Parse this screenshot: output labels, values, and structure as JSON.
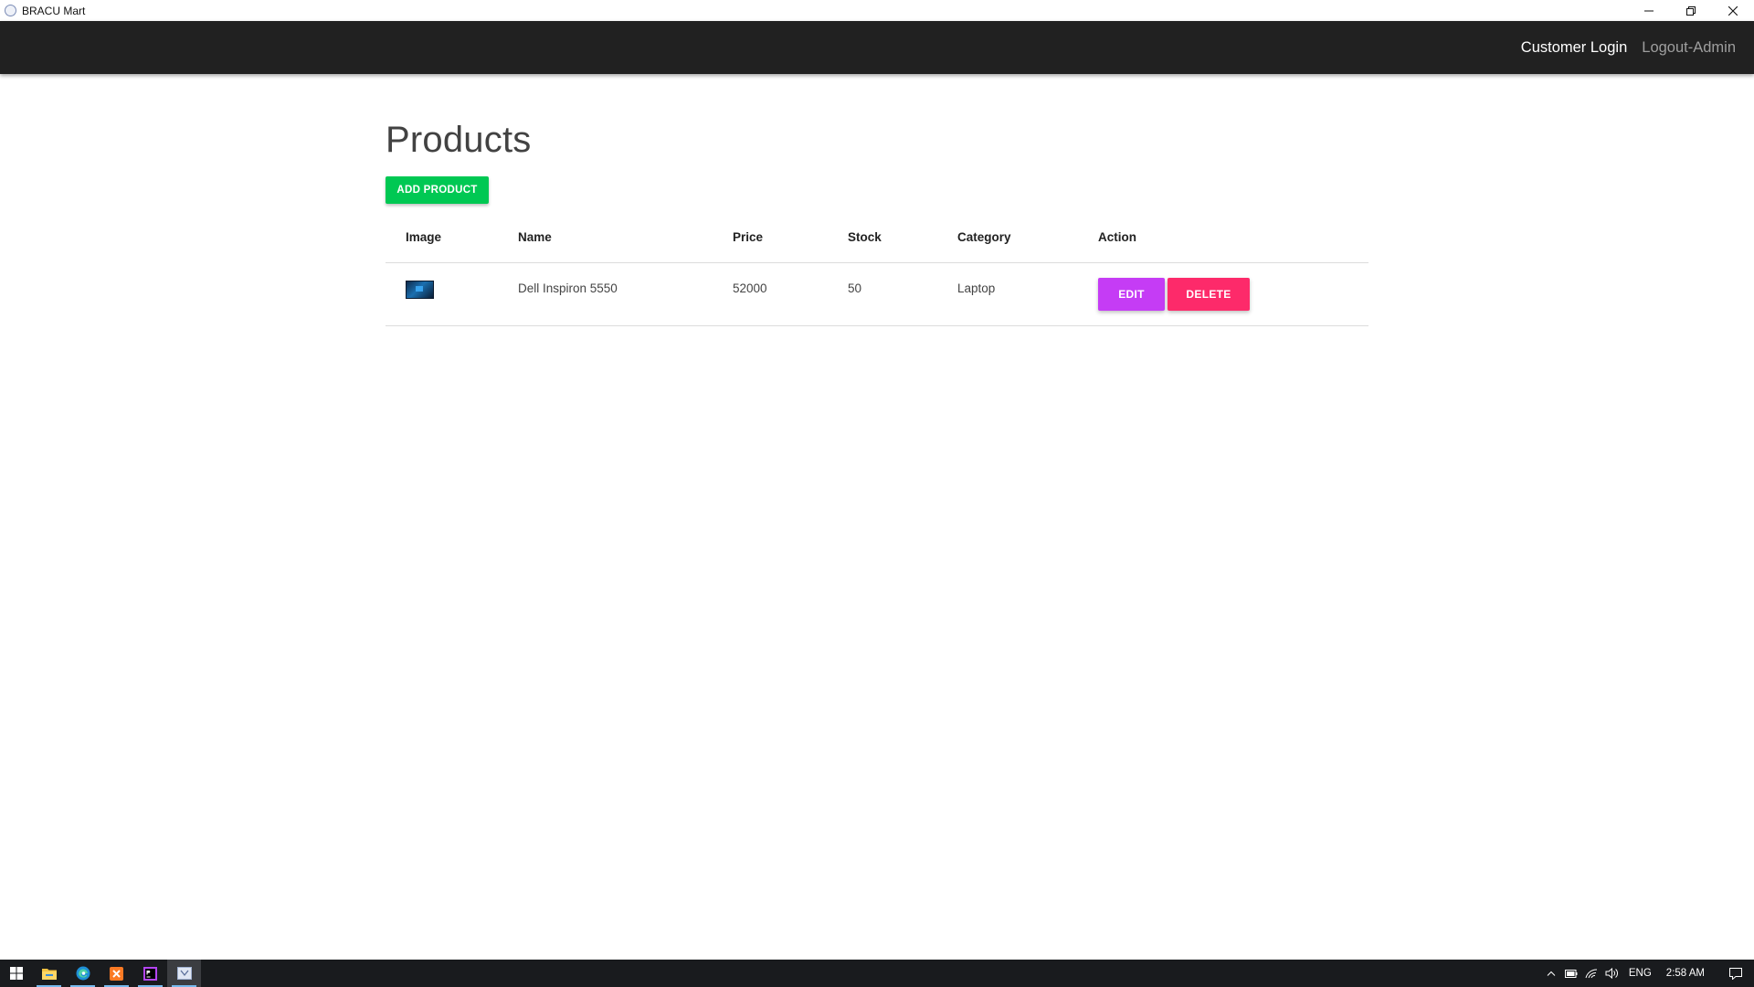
{
  "window": {
    "title": "BRACU Mart",
    "icon": "app-logo-icon",
    "controls": [
      "minimize-icon",
      "restore-icon",
      "close-icon"
    ]
  },
  "navbar": {
    "links": [
      {
        "label": "Customer Login"
      },
      {
        "label": "Logout-Admin"
      }
    ]
  },
  "page": {
    "title": "Products",
    "add_button": "ADD PRODUCT"
  },
  "table": {
    "headers": [
      "Image",
      "Name",
      "Price",
      "Stock",
      "Category",
      "Action"
    ],
    "rows": [
      {
        "image": "laptop-thumbnail",
        "name": "Dell Inspiron 5550",
        "price": "52000",
        "stock": "50",
        "category": "Laptop",
        "actions": [
          "EDIT",
          "DELETE"
        ]
      }
    ]
  },
  "colors": {
    "navbar": "#212121",
    "add_button": "#00c853",
    "edit_button": "#c53cf5",
    "delete_button": "#fd2a6a",
    "taskbar": "#191b1e"
  },
  "taskbar": {
    "apps": [
      "windows-start-icon",
      "file-explorer-icon",
      "edge-icon",
      "xampp-icon",
      "phpstorm-icon",
      "bracu-mart-app-icon"
    ],
    "tray": {
      "language": "ENG",
      "time": "2:58 AM"
    }
  }
}
